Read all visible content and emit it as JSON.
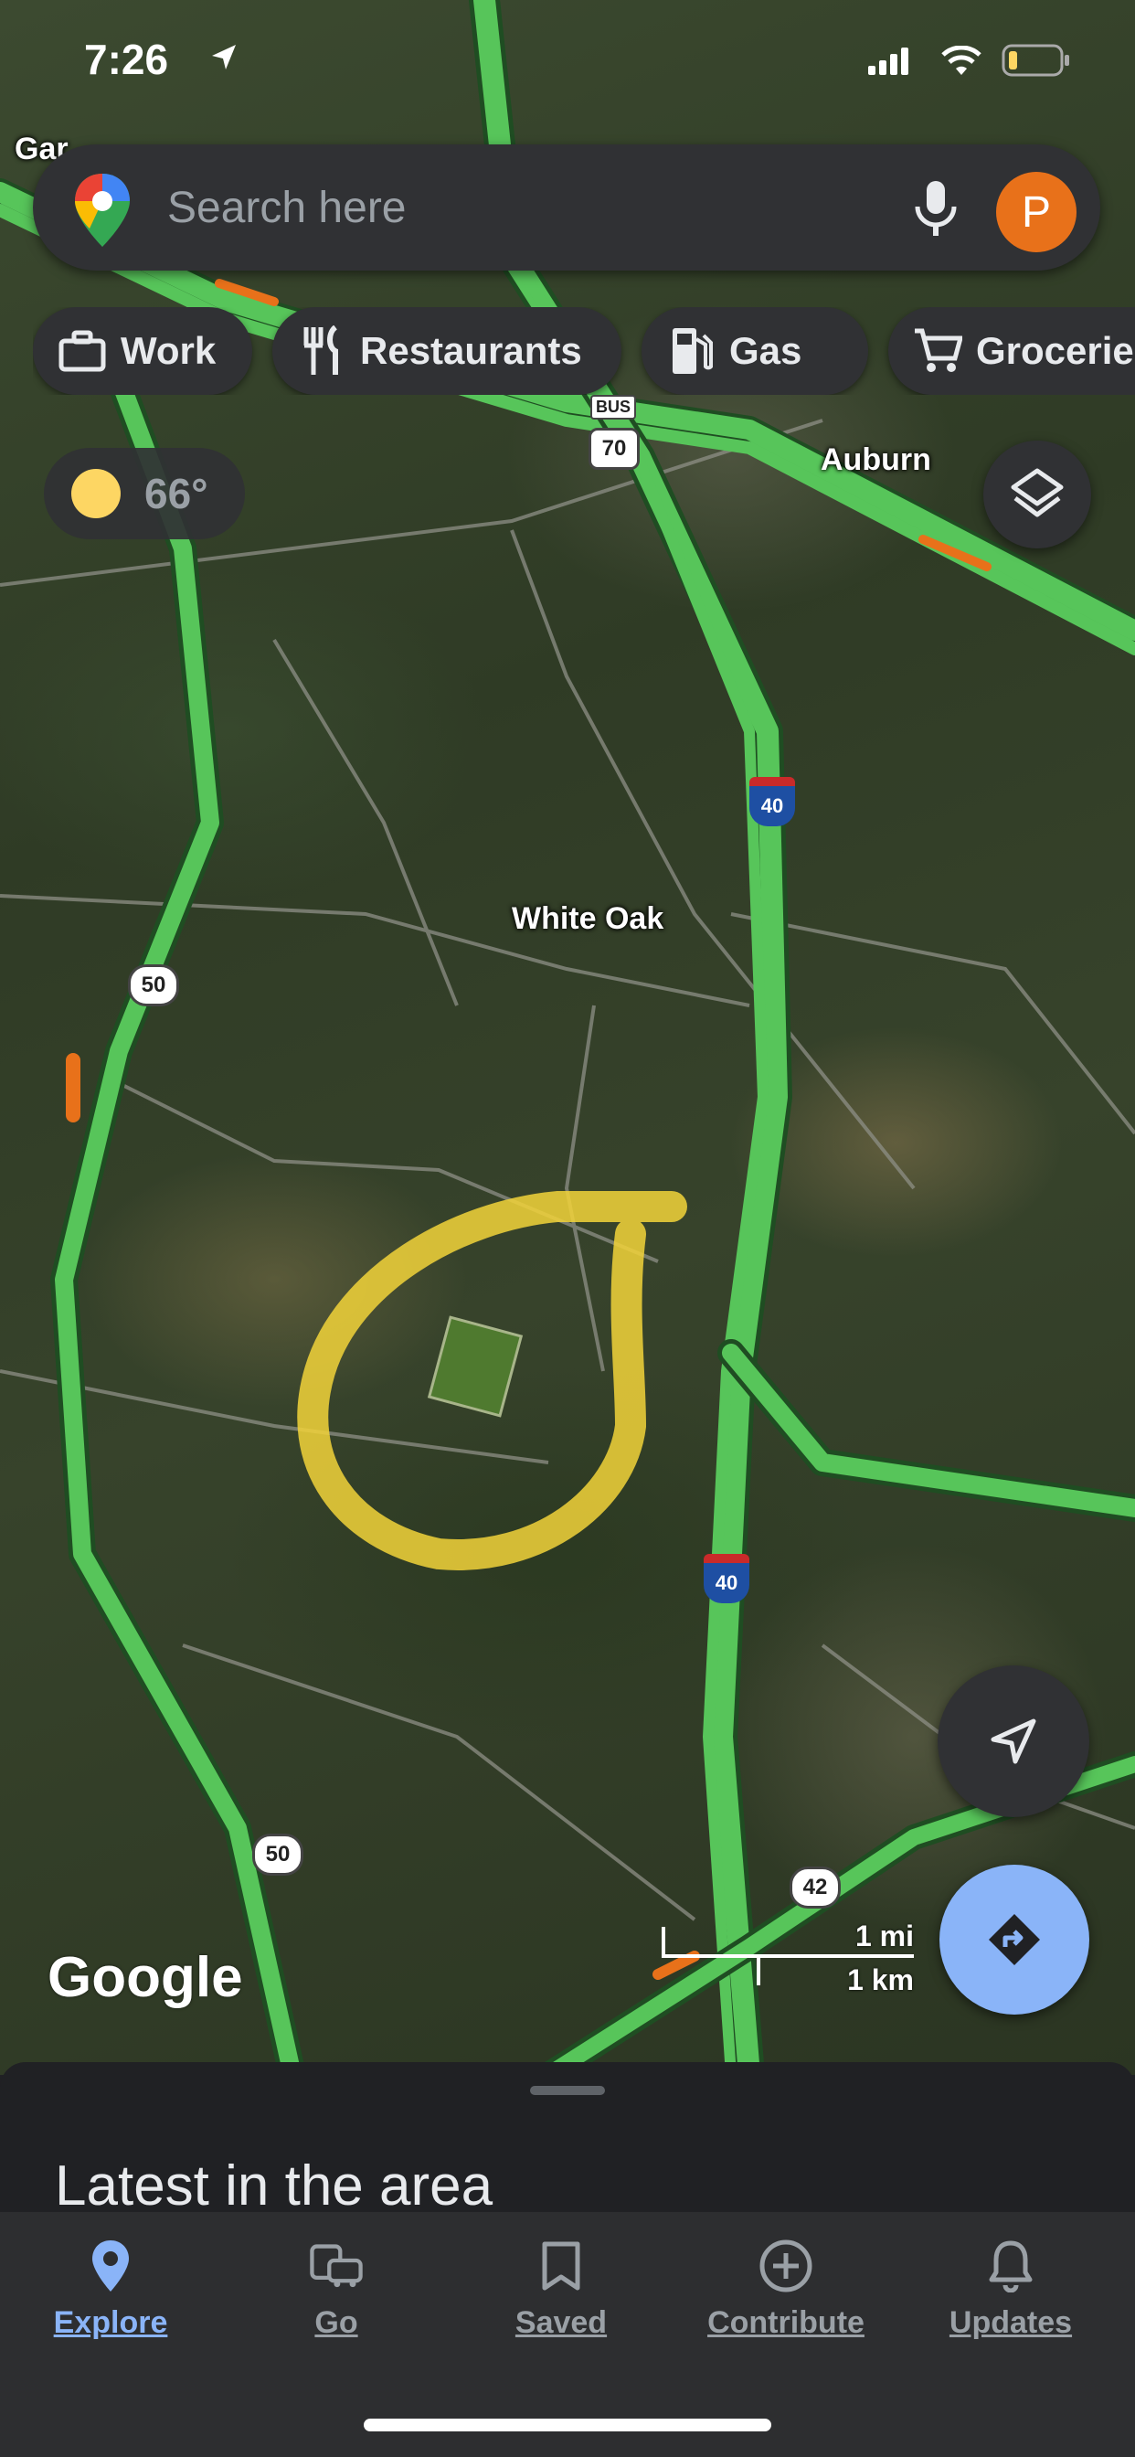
{
  "status_bar": {
    "time": "7:26"
  },
  "search": {
    "placeholder": "Search here",
    "avatar_letter": "P"
  },
  "chips": [
    {
      "label": "Work",
      "icon": "briefcase-icon"
    },
    {
      "label": "Restaurants",
      "icon": "fork-knife-icon"
    },
    {
      "label": "Gas",
      "icon": "gas-pump-icon"
    },
    {
      "label": "Groceries",
      "icon": "cart-icon"
    }
  ],
  "weather": {
    "temperature": "66°"
  },
  "map": {
    "places": [
      {
        "name": "Garner",
        "text": "Gar"
      },
      {
        "name": "Auburn",
        "text": "Auburn"
      },
      {
        "name": "White Oak",
        "text": "White Oak"
      }
    ],
    "route_shields": [
      "70",
      "40",
      "50",
      "50",
      "40",
      "42"
    ],
    "bus_tag": "BUS",
    "scale_mi": "1 mi",
    "scale_km": "1 km",
    "logo": "Google",
    "annotation_color": "#f2d33a"
  },
  "sheet": {
    "title": "Latest in the area"
  },
  "nav": [
    {
      "label": "Explore",
      "icon": "explore-pin-icon",
      "active": true
    },
    {
      "label": "Go",
      "icon": "commute-icon",
      "active": false
    },
    {
      "label": "Saved",
      "icon": "bookmark-icon",
      "active": false
    },
    {
      "label": "Contribute",
      "icon": "plus-circle-icon",
      "active": false
    },
    {
      "label": "Updates",
      "icon": "bell-icon",
      "active": false
    }
  ],
  "colors": {
    "accent": "#8ab4f8",
    "traffic_green": "#57c55a",
    "avatar": "#e8711a",
    "sun": "#fdd663"
  }
}
